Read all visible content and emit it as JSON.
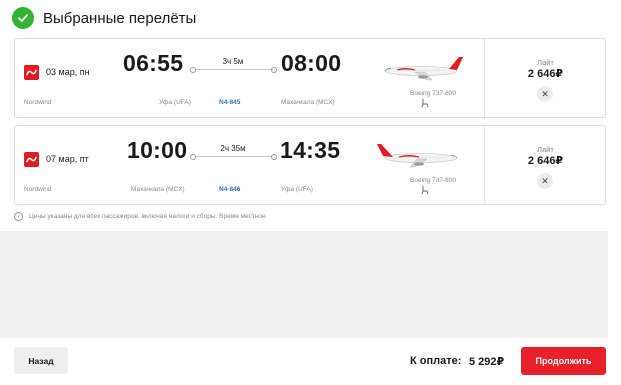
{
  "header": {
    "title": "Выбранные перелёты",
    "icon": "check-circle-icon",
    "accent": "#34b233"
  },
  "flights": [
    {
      "date": "03 мар, пн",
      "airline": "Nordwind",
      "dep_time": "06:55",
      "arr_time": "08:00",
      "duration": "3ч 5м",
      "dep_airport": "Уфа (UFA)",
      "arr_airport": "Махачкала (MCX)",
      "flight_no": "N4-845",
      "aircraft": "Boeing 737-800",
      "fare_name": "Лайт",
      "fare_price": "2 646₽"
    },
    {
      "date": "07 мар, пт",
      "airline": "Nordwind",
      "dep_time": "10:00",
      "arr_time": "14:35",
      "duration": "2ч 35м",
      "dep_airport": "Махачкала (MCX)",
      "arr_airport": "Уфа (UFA)",
      "flight_no": "N4-846",
      "aircraft": "Boeing 737-800",
      "fare_name": "Лайт",
      "fare_price": "2 646₽"
    }
  ],
  "note": "Цены указаны для всех пассажиров, включая налоги и сборы. Время местное.",
  "footer": {
    "back_label": "Назад",
    "total_label": "К оплате:",
    "total_value": "5 292₽",
    "continue_label": "Продолжить"
  },
  "colors": {
    "brand_red": "#e8202a",
    "link_blue": "#3a6fb5",
    "success_green": "#34b233"
  }
}
